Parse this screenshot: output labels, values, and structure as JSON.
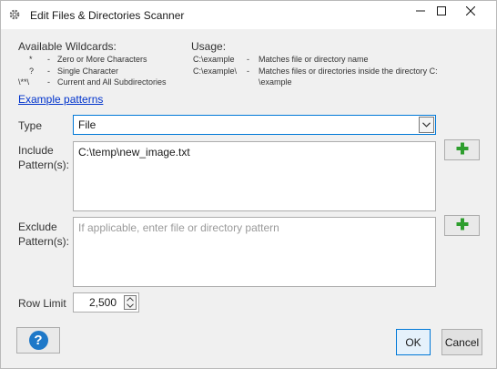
{
  "window": {
    "title": "Edit Files & Directories Scanner",
    "icons": {
      "app": "gear-icon",
      "minimize": "minimize-icon",
      "maximize": "maximize-icon",
      "close": "close-icon"
    }
  },
  "wildcards": {
    "title": "Available Wildcards:",
    "items": [
      {
        "symbol": "*",
        "dash": "-",
        "desc": "Zero or More Characters"
      },
      {
        "symbol": "?",
        "dash": "-",
        "desc": "Single Character"
      },
      {
        "symbol": "\\**\\",
        "dash": "-",
        "desc": "Current and All Subdirectories"
      }
    ]
  },
  "usage": {
    "title": "Usage:",
    "items": [
      {
        "example": "C:\\example",
        "dash": "-",
        "desc": "Matches file or directory name"
      },
      {
        "example": "C:\\example\\",
        "dash": "-",
        "desc": "Matches files or directories inside the directory C:"
      },
      {
        "example": "",
        "dash": "",
        "desc": "\\example"
      }
    ]
  },
  "example_link": "Example patterns",
  "type": {
    "label": "Type",
    "value": "File",
    "icon": "chevron-down-icon"
  },
  "include": {
    "label_line1": "Include",
    "label_line2": "Pattern(s):",
    "value": "C:\\temp\\new_image.txt"
  },
  "exclude": {
    "label_line1": "Exclude",
    "label_line2": "Pattern(s):",
    "placeholder": "If applicable, enter file or directory pattern"
  },
  "add_icon": "plus-icon",
  "add_color": "#2e9e2e",
  "row_limit": {
    "label": "Row Limit",
    "value": "2,500"
  },
  "buttons": {
    "help_icon": "help-icon",
    "help_glyph": "?",
    "ok": "OK",
    "cancel": "Cancel"
  },
  "colors": {
    "accent": "#0078d7",
    "link": "#0033cc",
    "help": "#1e78c8"
  }
}
